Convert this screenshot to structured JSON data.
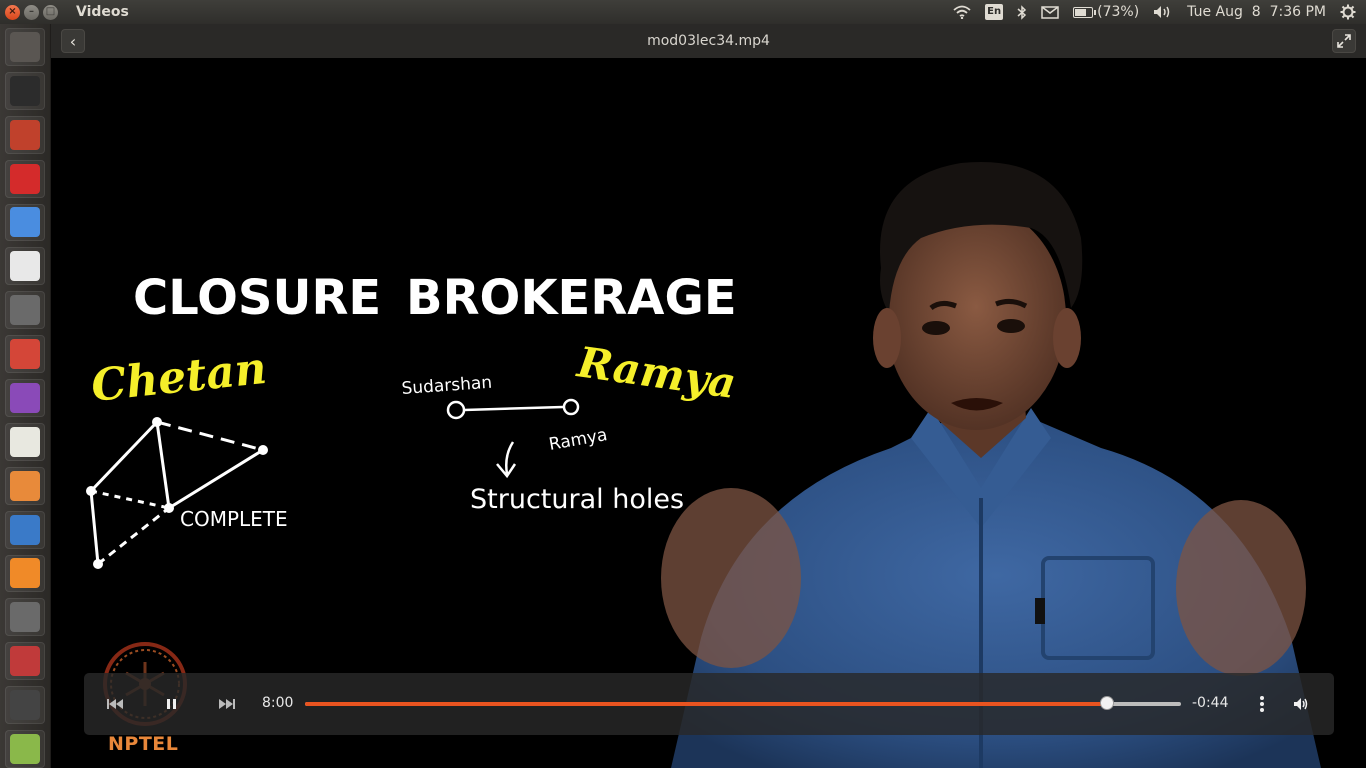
{
  "topbar": {
    "app_title": "Videos",
    "keyboard_layout": "En",
    "battery_text": "(73%)",
    "battery_level": 0.73,
    "clock": "Tue Aug  8  7:36 PM"
  },
  "launcher": {
    "items": [
      {
        "name": "ubuntu-dash-icon",
        "color": "#5a5652"
      },
      {
        "name": "terminal-icon",
        "color": "#2c2c2c"
      },
      {
        "name": "files-icon",
        "color": "#c0412c"
      },
      {
        "name": "opera-icon",
        "color": "#d42b2b"
      },
      {
        "name": "chrome-icon",
        "color": "#4a8de0"
      },
      {
        "name": "document-viewer-icon",
        "color": "#e8e8e8"
      },
      {
        "name": "video-editor-icon",
        "color": "#6a6a6a"
      },
      {
        "name": "gmail-icon",
        "color": "#d44638"
      },
      {
        "name": "webcam-icon",
        "color": "#8a4ab8"
      },
      {
        "name": "text-editor-icon",
        "color": "#e8e8e0"
      },
      {
        "name": "presentation-icon",
        "color": "#e88a3a"
      },
      {
        "name": "writer-icon",
        "color": "#3a7ac8"
      },
      {
        "name": "sublime-text-icon",
        "color": "#f08a28"
      },
      {
        "name": "ipython-icon",
        "color": "#6a6a6a"
      },
      {
        "name": "network-icon",
        "color": "#c03a3a"
      },
      {
        "name": "app-icon",
        "color": "#444444"
      },
      {
        "name": "software-center-icon",
        "color": "#8ab84a"
      }
    ]
  },
  "window": {
    "file_title": "mod03lec34.mp4"
  },
  "board": {
    "closure_title": "CLOSURE",
    "brokerage_title": "BROKERAGE",
    "name_chetan": "Chetan",
    "name_ramya_big": "Ramya",
    "label_sudarshan": "Sudarshan",
    "label_ramya_small": "Ramya",
    "label_complete": "COMPLETE",
    "label_structural_holes": "Structural holes"
  },
  "controls": {
    "current_time": "8:00",
    "remaining_time": "-0:44",
    "progress": 0.916
  },
  "overlay": {
    "nptel_label": "NPTEL"
  },
  "colors": {
    "accent": "#e95420",
    "handwriting_white": "#ffffff",
    "handwriting_yellow": "#f5ef2a",
    "nptel_orange": "#e8873a"
  }
}
